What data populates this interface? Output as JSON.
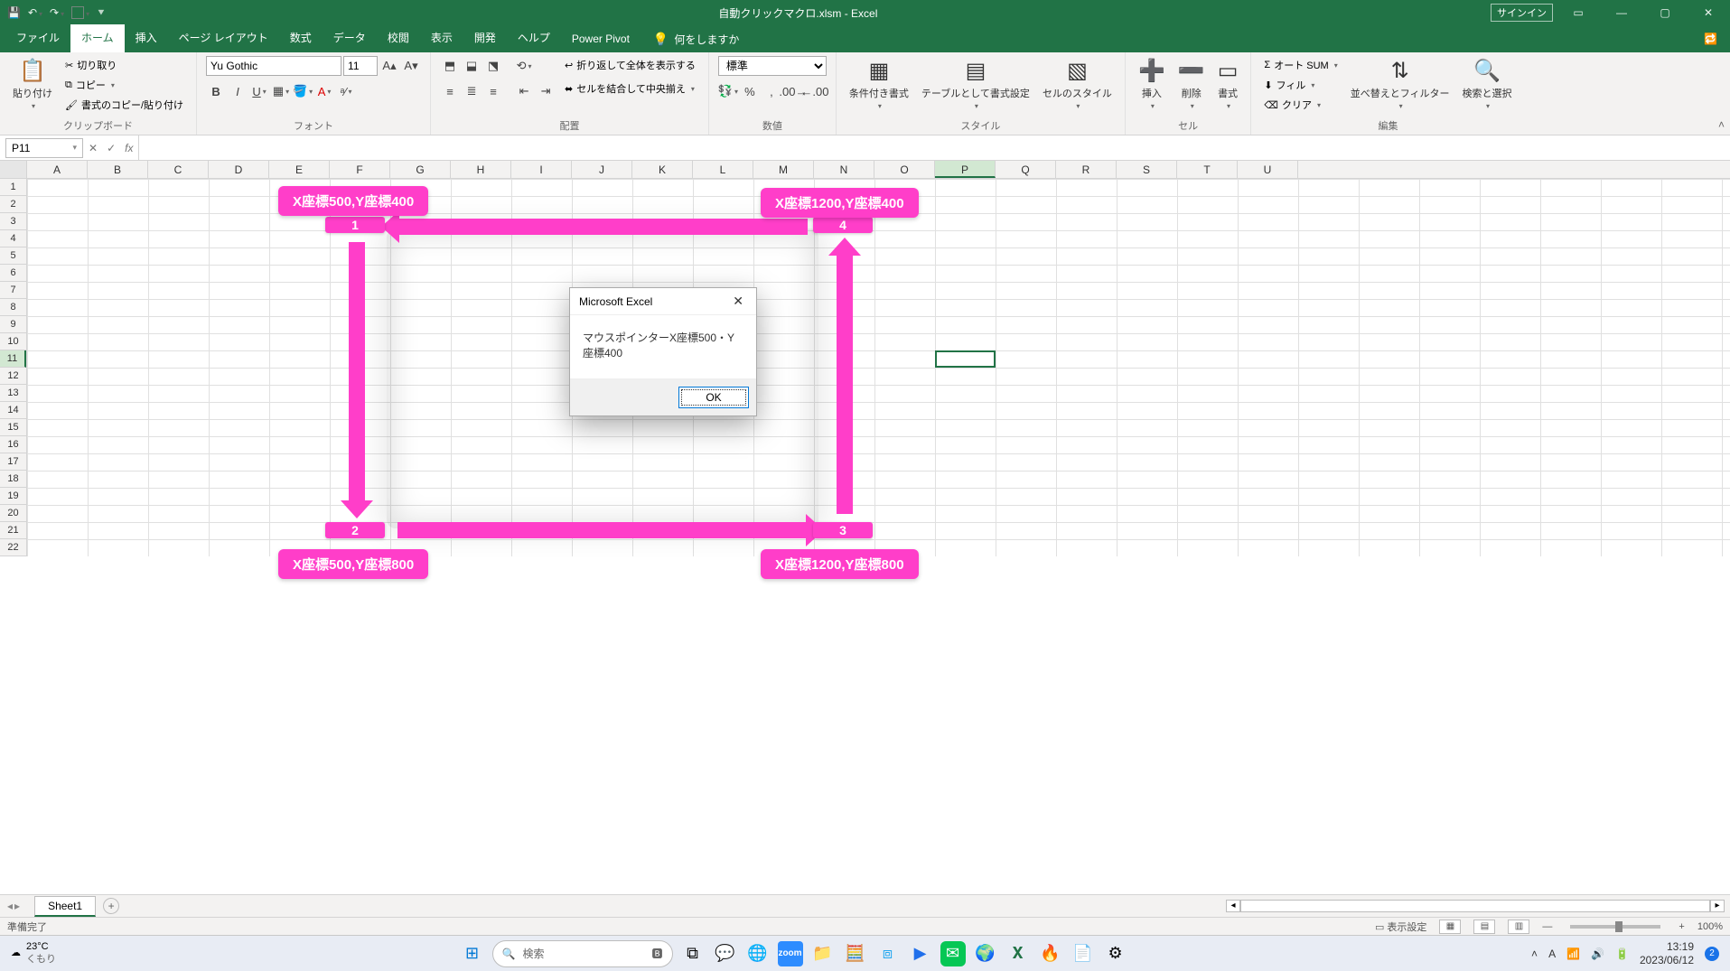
{
  "title": "自動クリックマクロ.xlsm  -  Excel",
  "signin": "サインイン",
  "tabs": {
    "file": "ファイル",
    "home": "ホーム",
    "insert": "挿入",
    "pagelayout": "ページ レイアウト",
    "formulas": "数式",
    "data": "データ",
    "review": "校閲",
    "view": "表示",
    "developer": "開発",
    "help": "ヘルプ",
    "powerpivot": "Power Pivot",
    "tell": "何をしますか"
  },
  "ribbon": {
    "clipboard": {
      "label": "クリップボード",
      "paste": "貼り付け",
      "cut": "切り取り",
      "copy": "コピー",
      "formatpainter": "書式のコピー/貼り付け"
    },
    "font": {
      "label": "フォント",
      "name": "Yu Gothic",
      "size": "11"
    },
    "alignment": {
      "label": "配置",
      "wrap": "折り返して全体を表示する",
      "merge": "セルを結合して中央揃え"
    },
    "number": {
      "label": "数値",
      "format": "標準"
    },
    "styles": {
      "label": "スタイル",
      "condfmt": "条件付き書式",
      "fmttable": "テーブルとして書式設定",
      "cellstyles": "セルのスタイル"
    },
    "cells": {
      "label": "セル",
      "insert": "挿入",
      "delete": "削除",
      "format": "書式"
    },
    "editing": {
      "label": "編集",
      "autosum": "オート SUM",
      "fill": "フィル",
      "clear": "クリア",
      "sort": "並べ替えとフィルター",
      "find": "検索と選択"
    }
  },
  "namebox": "P11",
  "sheet": {
    "name": "Sheet1"
  },
  "columns": [
    "A",
    "B",
    "C",
    "D",
    "E",
    "F",
    "G",
    "H",
    "I",
    "J",
    "K",
    "L",
    "M",
    "N",
    "O",
    "P",
    "Q",
    "R",
    "S",
    "T",
    "U"
  ],
  "rows_count": 22,
  "selected": {
    "col": "P",
    "row": 11
  },
  "shapes": {
    "tl": "X座標500,Y座標400",
    "tr": "X座標1200,Y座標400",
    "bl": "X座標500,Y座標800",
    "br": "X座標1200,Y座標800",
    "n1": "1",
    "n2": "2",
    "n3": "3",
    "n4": "4"
  },
  "msgbox": {
    "title": "Microsoft Excel",
    "body": "マウスポインターX座標500・Y座標400",
    "ok": "OK"
  },
  "status": {
    "ready": "準備完了",
    "display": "表示設定",
    "zoom": "100%"
  },
  "taskbar": {
    "weather_temp": "23°C",
    "weather_desc": "くもり",
    "search": "検索",
    "time": "13:19",
    "date": "2023/06/12",
    "notif": "2"
  }
}
